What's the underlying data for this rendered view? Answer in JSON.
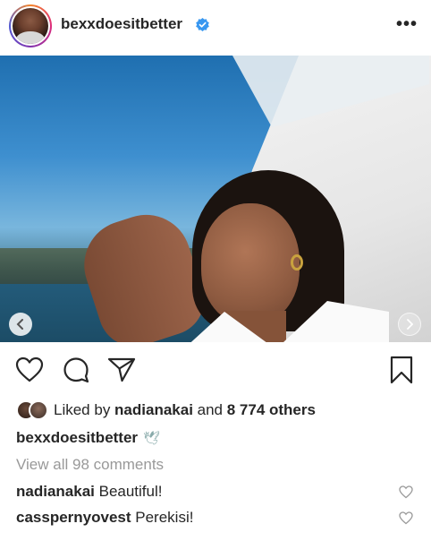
{
  "header": {
    "username": "bexxdoesitbetter",
    "verified_icon": "verified-badge-icon",
    "more_label": "•••"
  },
  "photo": {
    "prev_icon": "chevron-left-icon",
    "next_icon": "chevron-right-icon"
  },
  "actions": {
    "like_icon": "heart-outline-icon",
    "comment_icon": "comment-bubble-icon",
    "share_icon": "paper-plane-icon",
    "save_icon": "bookmark-icon"
  },
  "likes": {
    "prefix": "Liked by ",
    "liked_by_user": "nadianakai",
    "middle": " and ",
    "others": "8 774 others"
  },
  "caption": {
    "username": "bexxdoesitbetter",
    "emoji": "🕊"
  },
  "view_all_comments": "View all 98 comments",
  "comments": [
    {
      "username": "nadianakai",
      "text": "Beautiful!"
    },
    {
      "username": "casspernyovest",
      "text": "Perekisi!"
    }
  ],
  "colors": {
    "text": "#262626",
    "muted": "#999999",
    "verified": "#3897f0"
  }
}
